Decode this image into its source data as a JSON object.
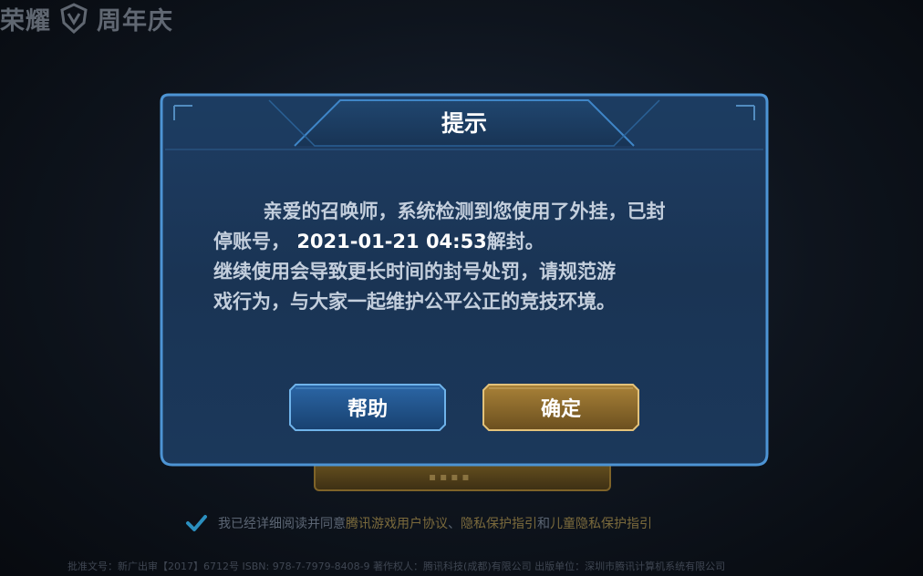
{
  "header": {
    "logo_text_left": "荣耀",
    "logo_text_right": "周年庆"
  },
  "dialog": {
    "title": "提示",
    "message_line1": "亲爱的召唤师，系统检测到您使用了外挂，已封",
    "message_line2_prefix": "停账号，",
    "message_line2_date": "2021-01-21 04:53",
    "message_line2_suffix": "解封。",
    "message_line3": "继续使用会导致更长时间的封号处罚，请规范游",
    "message_line4": "戏行为，与大家一起维护公平公正的竞技环境。",
    "help_label": "帮助",
    "confirm_label": "确定"
  },
  "agreement": {
    "prefix": "我已经详细阅读并同意",
    "link1": "腾讯游戏用户协议",
    "sep1": "、",
    "link2": "隐私保护指引",
    "sep2": "和",
    "link3": "儿童隐私保护指引"
  },
  "footer": {
    "license": "批准文号：新广出审【2017】6712号  ISBN: 978-7-7979-8408-9  著作权人：腾讯科技(成都)有限公司  出版单位：深圳市腾讯计算机系统有限公司"
  },
  "colors": {
    "dialog_bg": "#1b3556",
    "dialog_border": "#4a8fd0",
    "help_button": "#1f4f86",
    "confirm_button": "#8a6a2c"
  },
  "icons": [
    "shield-logo-icon",
    "checkmark-icon"
  ]
}
